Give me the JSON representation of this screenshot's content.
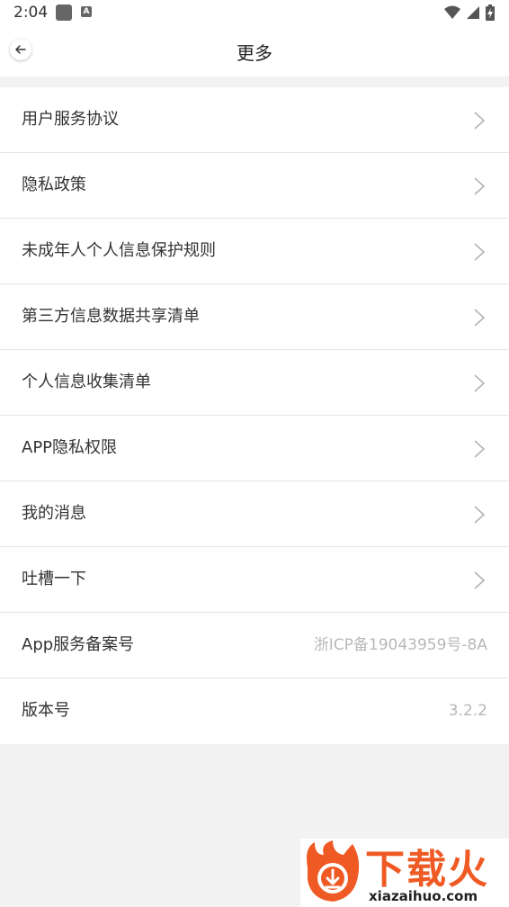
{
  "status_bar": {
    "time": "2:04",
    "notification_letter": "A"
  },
  "header": {
    "title": "更多"
  },
  "menu": {
    "items": [
      {
        "label": "用户服务协议"
      },
      {
        "label": "隐私政策"
      },
      {
        "label": "未成年人个人信息保护规则"
      },
      {
        "label": "第三方信息数据共享清单"
      },
      {
        "label": "个人信息收集清单"
      },
      {
        "label": "APP隐私权限"
      },
      {
        "label": "我的消息"
      },
      {
        "label": "吐槽一下"
      },
      {
        "label": "App服务备案号",
        "value": "浙ICP备19043959号-8A"
      },
      {
        "label": "版本号",
        "value": "3.2.2"
      }
    ]
  },
  "watermark": {
    "title": "下载火",
    "url": "xiazaihuo.com"
  },
  "colors": {
    "background": "#f2f2f2",
    "surface": "#ffffff",
    "text": "#333333",
    "muted": "#b8b8b8",
    "brand": "#ef5a24"
  }
}
